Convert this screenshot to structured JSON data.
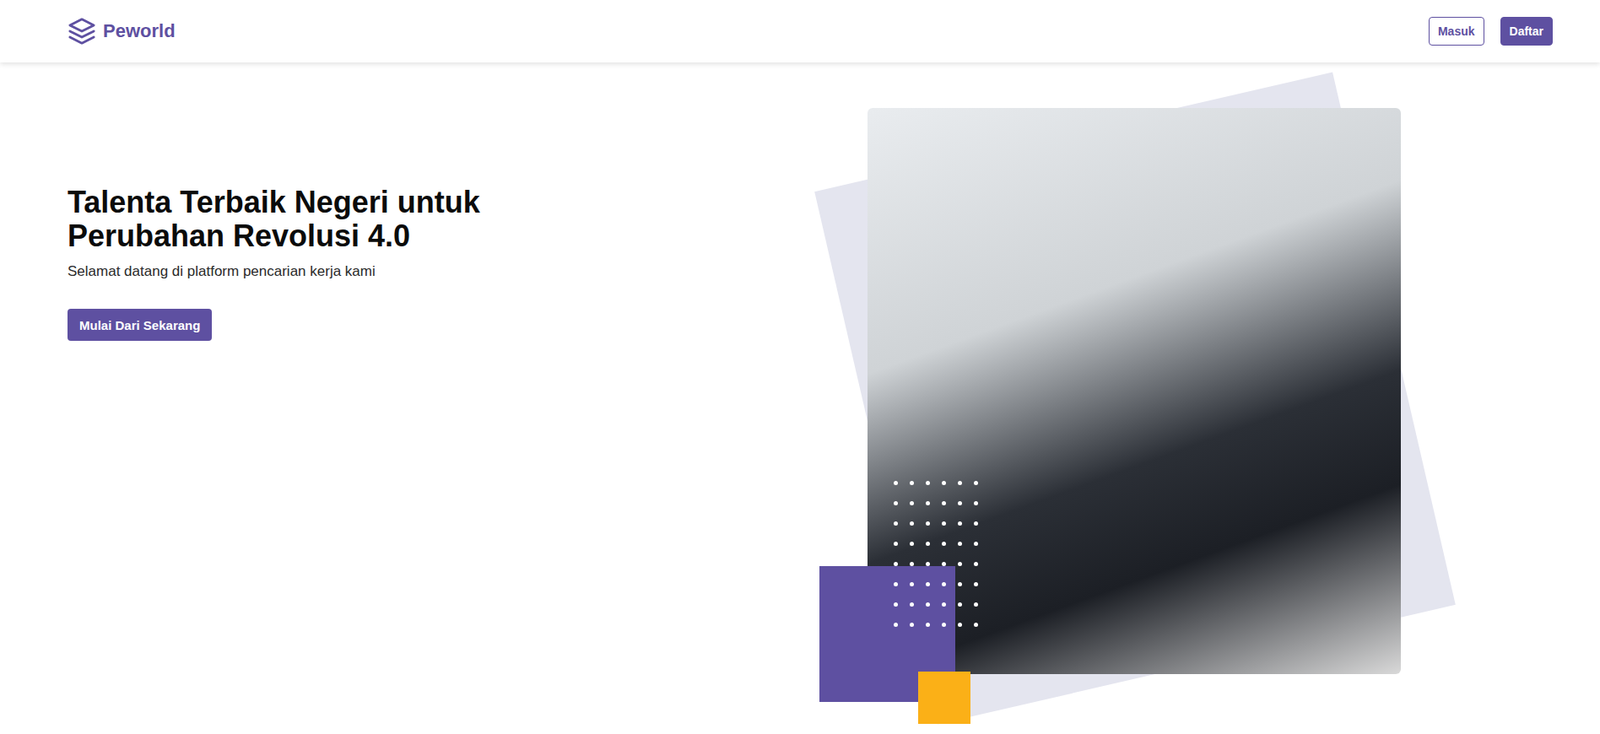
{
  "header": {
    "logo": "Peworld",
    "buttons": [
      {
        "label": "Masuk",
        "kind": "outline"
      },
      {
        "label": "Daftar",
        "kind": "filled"
      }
    ]
  },
  "hero": {
    "title": [
      "Talenta Terbaik Negeri untuk",
      "Perubahan Revolusi 4.0"
    ],
    "subtitle": "Selamat datang di platform pencarian kerja kami",
    "cta": "Mulai Dari Sekarang"
  }
}
